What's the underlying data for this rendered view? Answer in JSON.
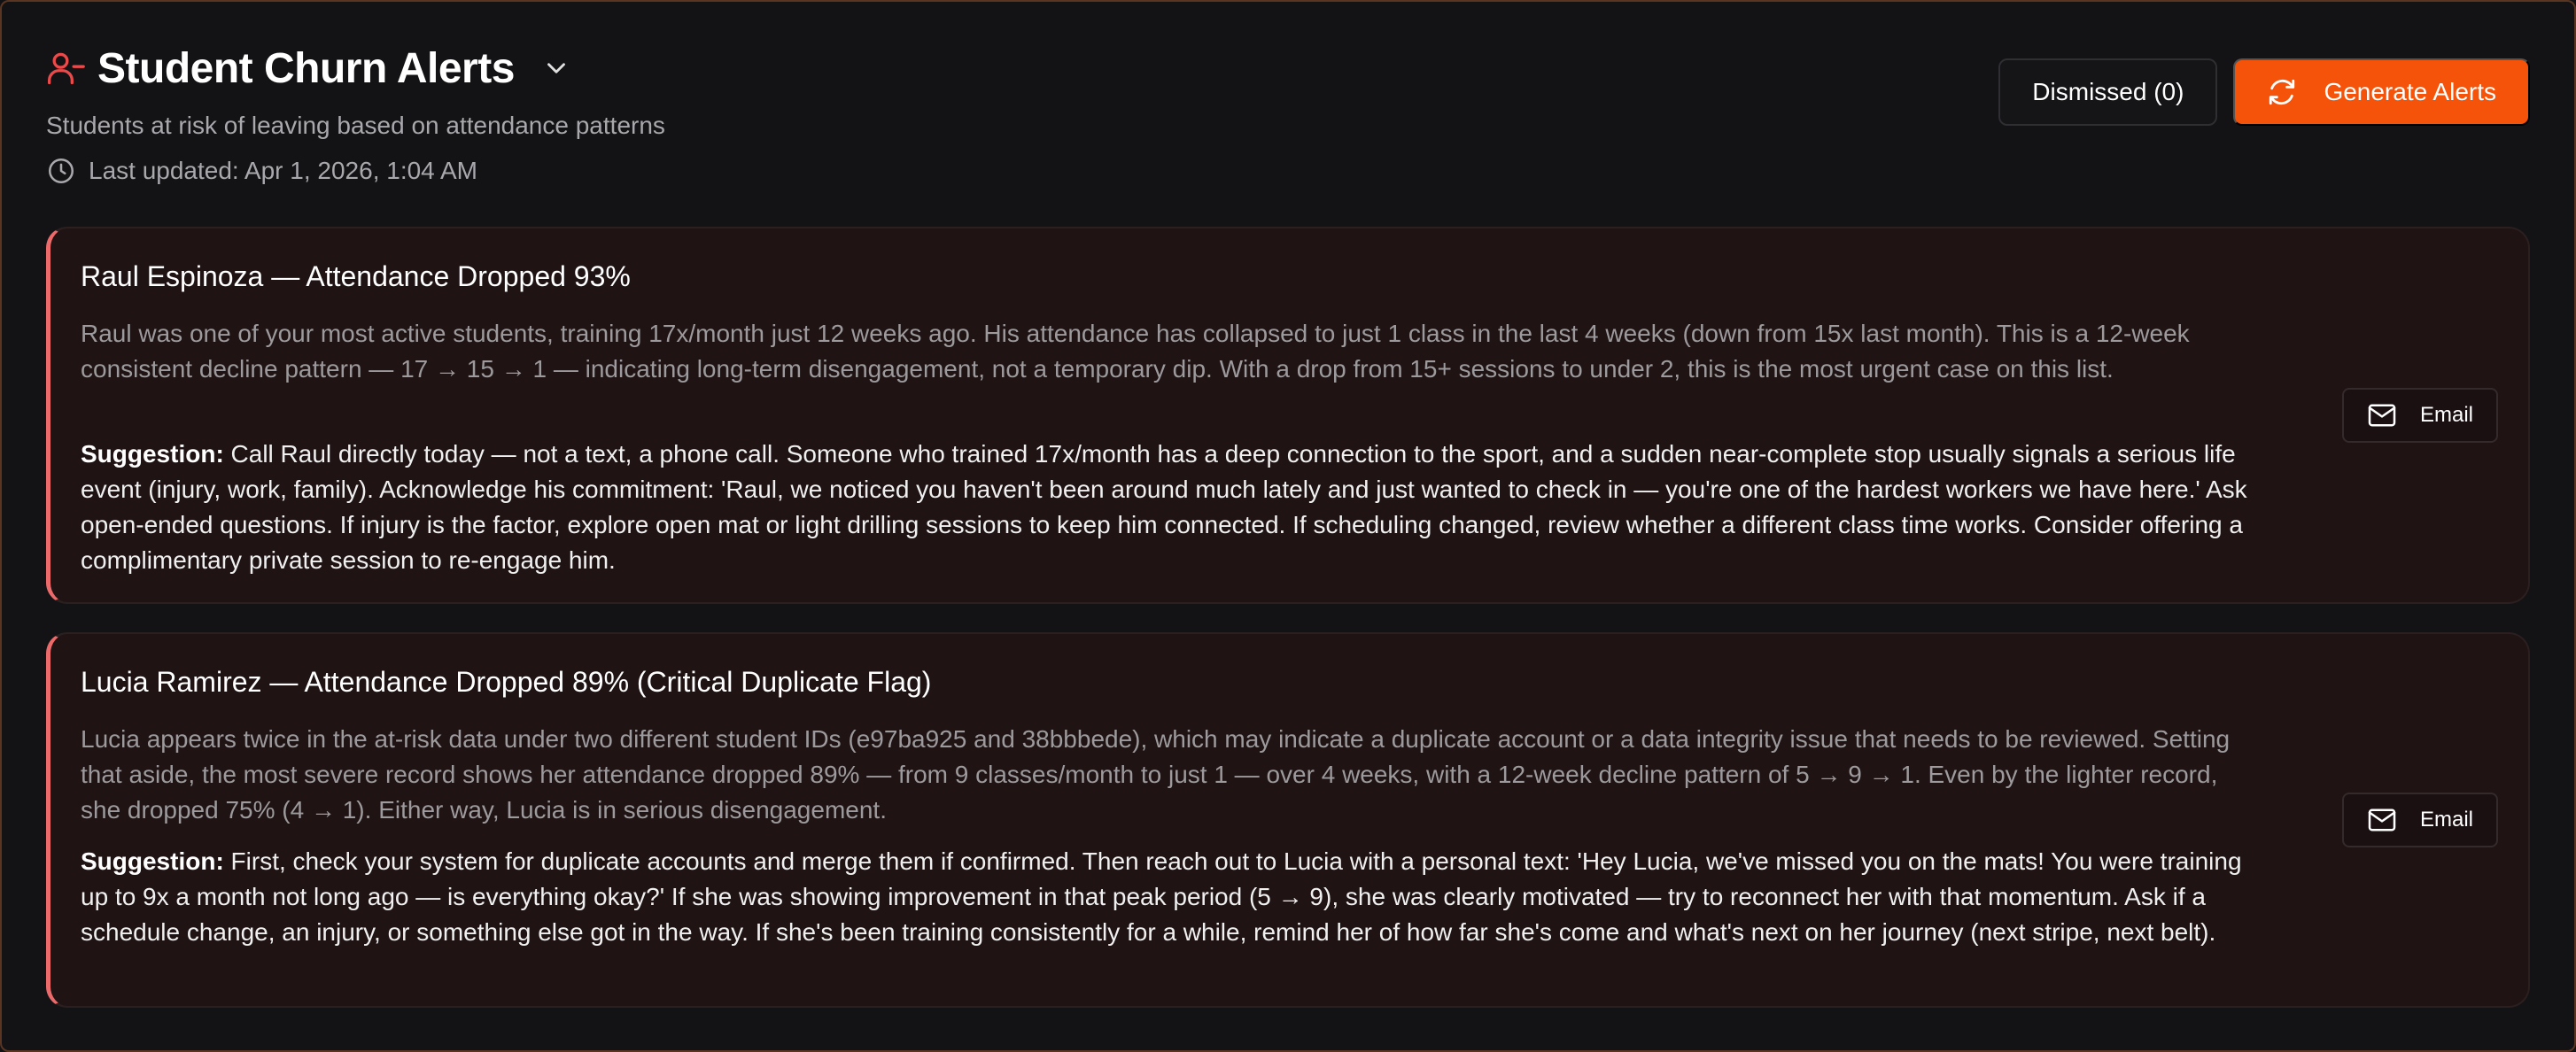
{
  "header": {
    "title": "Student Churn Alerts",
    "subtitle": "Students at risk of leaving based on attendance patterns",
    "last_updated": "Last updated: Apr 1, 2026, 1:04 AM"
  },
  "actions": {
    "dismissed_label": "Dismissed (0)",
    "generate_label": "Generate Alerts"
  },
  "colors": {
    "accent": "#f55309",
    "alert_border": "#ec6a6a",
    "card_bg": "#1f1314"
  },
  "icons": {
    "title": "user-minus-icon",
    "dropdown": "chevron-down-icon",
    "updated": "clock-icon",
    "generate": "refresh-icon",
    "email": "mail-icon"
  },
  "alerts": [
    {
      "title": "Raul Espinoza — Attendance Dropped 93%",
      "body": "Raul was one of your most active students, training 17x/month just 12 weeks ago. His attendance has collapsed to just 1 class in the last 4 weeks (down from 15x last month). This is a 12-week consistent decline pattern — 17 → 15 → 1 — indicating long-term disengagement, not a temporary dip. With a drop from 15+ sessions to under 2, this is the most urgent case on this list.",
      "suggestion_label": "Suggestion:",
      "suggestion": "Call Raul directly today — not a text, a phone call. Someone who trained 17x/month has a deep connection to the sport, and a sudden near-complete stop usually signals a serious life event (injury, work, family). Acknowledge his commitment: 'Raul, we noticed you haven't been around much lately and just wanted to check in — you're one of the hardest workers we have here.' Ask open-ended questions. If injury is the factor, explore open mat or light drilling sessions to keep him connected. If scheduling changed, review whether a different class time works. Consider offering a complimentary private session to re-engage him.",
      "email_label": "Email"
    },
    {
      "title": "Lucia Ramirez — Attendance Dropped 89% (Critical Duplicate Flag)",
      "body": "Lucia appears twice in the at-risk data under two different student IDs (e97ba925 and 38bbbede), which may indicate a duplicate account or a data integrity issue that needs to be reviewed. Setting that aside, the most severe record shows her attendance dropped 89% — from 9 classes/month to just 1 — over 4 weeks, with a 12-week decline pattern of 5 → 9 → 1. Even by the lighter record, she dropped 75% (4 → 1). Either way, Lucia is in serious disengagement.",
      "suggestion_label": "Suggestion:",
      "suggestion": "First, check your system for duplicate accounts and merge them if confirmed. Then reach out to Lucia with a personal text: 'Hey Lucia, we've missed you on the mats! You were training up to 9x a month not long ago — is everything okay?' If she was showing improvement in that peak period (5 → 9), she was clearly motivated — try to reconnect her with that momentum. Ask if a schedule change, an injury, or something else got in the way. If she's been training consistently for a while, remind her of how far she's come and what's next on her journey (next stripe, next belt).",
      "email_label": "Email"
    }
  ]
}
